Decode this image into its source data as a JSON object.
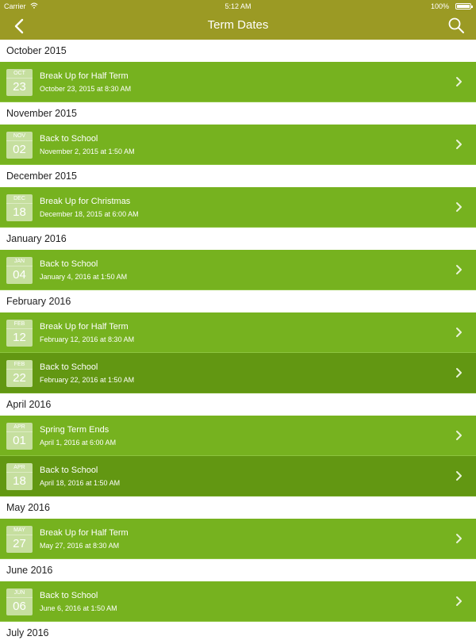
{
  "status": {
    "carrier": "Carrier",
    "time": "5:12 AM",
    "battery": "100%"
  },
  "nav": {
    "title": "Term Dates"
  },
  "colors": {
    "header": "#9b9a24",
    "row": "#76b21f",
    "row_selected": "#629712"
  },
  "icons": [
    "back-icon",
    "search-icon",
    "chevron-right-icon",
    "wifi-icon",
    "battery-icon",
    "calendar-icon"
  ],
  "sections": [
    {
      "month": "October 2015",
      "events": [
        {
          "mon": "OCT",
          "day": "23",
          "title": "Break Up for Half Term",
          "date": "October 23, 2015 at 8:30 AM",
          "dark": false
        }
      ]
    },
    {
      "month": "November 2015",
      "events": [
        {
          "mon": "NOV",
          "day": "02",
          "title": "Back to School",
          "date": "November 2, 2015 at 1:50 AM",
          "dark": false
        }
      ]
    },
    {
      "month": "December 2015",
      "events": [
        {
          "mon": "DEC",
          "day": "18",
          "title": "Break Up for Christmas",
          "date": "December 18, 2015 at 6:00 AM",
          "dark": false
        }
      ]
    },
    {
      "month": "January 2016",
      "events": [
        {
          "mon": "JAN",
          "day": "04",
          "title": "Back to School",
          "date": "January 4, 2016 at 1:50 AM",
          "dark": false
        }
      ]
    },
    {
      "month": "February 2016",
      "events": [
        {
          "mon": "FEB",
          "day": "12",
          "title": "Break Up for Half Term",
          "date": "February 12, 2016 at 8:30 AM",
          "dark": false
        },
        {
          "mon": "FEB",
          "day": "22",
          "title": "Back to School",
          "date": "February 22, 2016 at 1:50 AM",
          "dark": true
        }
      ]
    },
    {
      "month": "April 2016",
      "events": [
        {
          "mon": "APR",
          "day": "01",
          "title": "Spring Term Ends",
          "date": "April 1, 2016 at 6:00 AM",
          "dark": false
        },
        {
          "mon": "APR",
          "day": "18",
          "title": "Back to School",
          "date": "April 18, 2016 at 1:50 AM",
          "dark": true
        }
      ]
    },
    {
      "month": "May 2016",
      "events": [
        {
          "mon": "MAY",
          "day": "27",
          "title": "Break Up for Half Term",
          "date": "May 27, 2016 at 8:30 AM",
          "dark": false
        }
      ]
    },
    {
      "month": "June 2016",
      "events": [
        {
          "mon": "JUN",
          "day": "06",
          "title": "Back to School",
          "date": "June 6, 2016 at 1:50 AM",
          "dark": false
        }
      ]
    },
    {
      "month": "July 2016",
      "events": []
    }
  ]
}
